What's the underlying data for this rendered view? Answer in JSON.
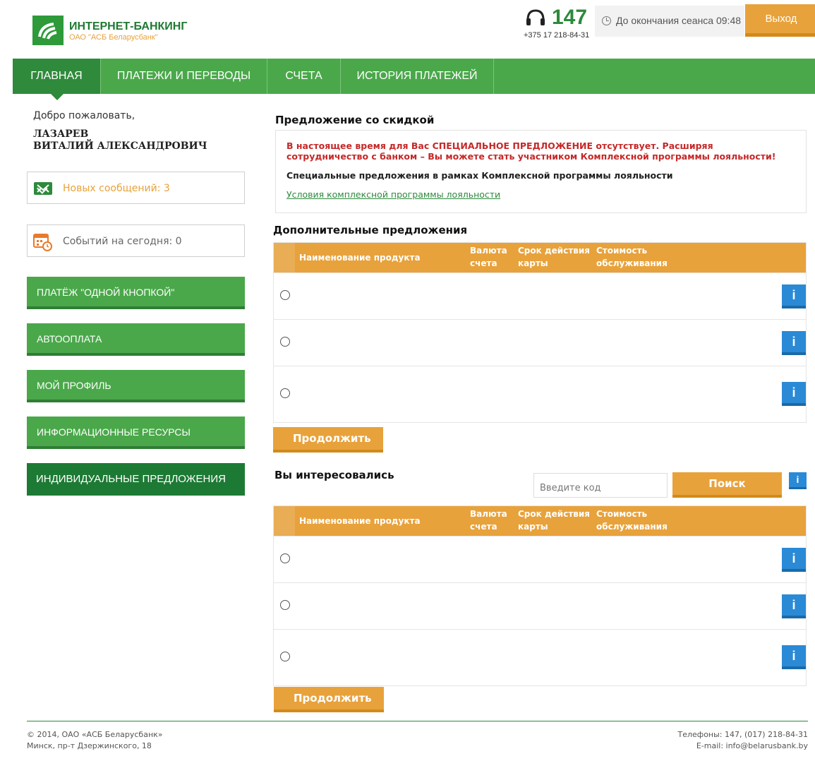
{
  "header": {
    "logo_title": "ИНТЕРНЕТ-БАНКИНГ",
    "logo_subtitle": "ОАО \"АСБ Беларусбанк\"",
    "phone_short": "147",
    "phone_full": "+375 17 218-84-31",
    "session_text": "До окончания сеанса 09:48",
    "logout_label": "Выход"
  },
  "nav": {
    "items": [
      {
        "label": "ГЛАВНАЯ"
      },
      {
        "label": "ПЛАТЕЖИ И ПЕРЕВОДЫ"
      },
      {
        "label": "СЧЕТА"
      },
      {
        "label": "ИСТОРИЯ ПЛАТЕЖЕЙ"
      }
    ]
  },
  "sidebar": {
    "welcome": "Добро пожаловать,",
    "user_line1": "ЛАЗАРЕВ",
    "user_line2": "ВИТАЛИЙ АЛЕКСАНДРОВИЧ",
    "messages": "Новых сообщений: 3",
    "events": "Событий на сегодня: 0",
    "buttons": [
      {
        "label": "ПЛАТЁЖ \"ОДНОЙ КНОПКОЙ\""
      },
      {
        "label": "АВТООПЛАТА"
      },
      {
        "label": "МОЙ ПРОФИЛЬ"
      },
      {
        "label": "ИНФОРМАЦИОННЫЕ РЕСУРСЫ"
      },
      {
        "label": "ИНДИВИДУАЛЬНЫЕ ПРЕДЛОЖЕНИЯ"
      }
    ]
  },
  "discount": {
    "title": "Предложение со скидкой",
    "red_text": "В настоящее время для Вас СПЕЦИАЛЬНОЕ ПРЕДЛОЖЕНИЕ отсутствует. Расширяя сотрудничество с банком – Вы можете стать участником Комплексной программы лояльности!",
    "black_text": "Специальные предложения в рамках Комплексной программы лояльности",
    "link_text": "Условия комплексной программы лояльности"
  },
  "additional": {
    "title": "Дополнительные предложения",
    "columns": [
      "Наименование продукта",
      "Валюта\nсчета",
      "Срок действия\nкарты",
      "Стоимость\nобслуживания"
    ],
    "info_label": "i",
    "continue_label": "Продолжить"
  },
  "interested": {
    "title": "Вы интересовались",
    "search_placeholder": "Введите код",
    "search_label": "Поиск",
    "info_label": "i",
    "columns": [
      "Наименование продукта",
      "Валюта\nсчета",
      "Срок действия\nкарты",
      "Стоимость\nобслуживания"
    ],
    "continue_label": "Продолжить"
  },
  "footer": {
    "copyright": "© 2014, ОАО «АСБ Беларусбанк»",
    "address": "Минск, пр-т Дзержинского, 18",
    "phones": "Телефоны: 147, (017) 218-84-31",
    "email": "E-mail: info@belarusbank.by"
  },
  "colors": {
    "brand_green": "#4aa84a",
    "dark_green": "#1d7a34",
    "accent_orange": "#e8a23b",
    "info_blue": "#2a8ad6",
    "alert_red": "#c62828"
  }
}
